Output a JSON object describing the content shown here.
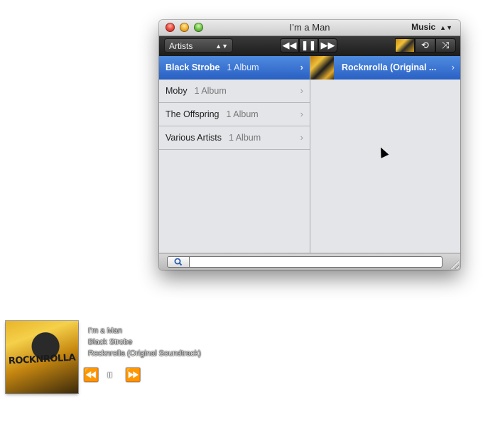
{
  "window": {
    "title": "I’m a Man",
    "source_label": "Music"
  },
  "toolbar": {
    "view_label": "Artists",
    "prev_icon": "rewind-icon",
    "pause_icon": "pause-icon",
    "next_icon": "fast-forward-icon",
    "repeat_icon": "repeat-icon",
    "shuffle_icon": "shuffle-icon"
  },
  "artists": [
    {
      "name": "Black Strobe",
      "count": "1 Album",
      "selected": true
    },
    {
      "name": "Moby",
      "count": "1 Album",
      "selected": false
    },
    {
      "name": "The Offspring",
      "count": "1 Album",
      "selected": false
    },
    {
      "name": "Various Artists",
      "count": "1 Album",
      "selected": false
    }
  ],
  "albums": [
    {
      "title": "Rocknrolla (Original ..."
    }
  ],
  "search": {
    "value": "",
    "placeholder": ""
  },
  "now_playing": {
    "track": "I'm a Man",
    "artist": "Black Strobe",
    "album": "Rocknrolla (Original Soundtrack)",
    "art_text": "ROCKNROLLA"
  },
  "colors": {
    "selection": "#3a74d4",
    "toolbar": "#2a2a2a",
    "list_bg": "#e3e5e8"
  }
}
